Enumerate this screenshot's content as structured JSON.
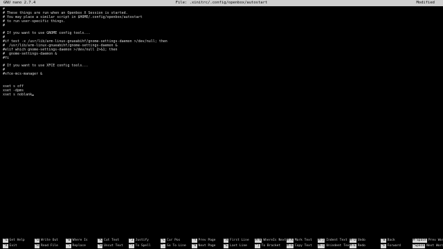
{
  "titlebar": {
    "app": "GNU nano 2.7.4",
    "file": "File: .xinitrc/.config/openbox/autostart",
    "status": "Modified"
  },
  "editor": {
    "lines": [
      "#",
      "# These things are run when an Openbox X Session is started.",
      "# You may place a similar script in $HOME/.config/openbox/autostart",
      "# to run user-specific things.",
      "#",
      "",
      "# If you want to use GNOME config tools...",
      "#",
      "#if test -x /usr/lib/arm-linux-gnueabihf/gnome-settings-daemon >/dev/null; then",
      "#  /usr/lib/arm-linux-gnueabihf/gnome-settings-daemon &",
      "#elif which gnome-settings-daemon >/dev/null 2>&1; then",
      "#  gnome-settings-daemon &",
      "#fi",
      "",
      "# If you want to use XFCE config tools...",
      "#",
      "#xfce-mcs-manager &",
      "",
      "",
      "xset s off",
      "xset -dpms",
      "xset s noblank",
      ""
    ]
  },
  "shortcuts": [
    {
      "k1": "^G",
      "l1": "Get Help",
      "k2": "^X",
      "l2": "Exit"
    },
    {
      "k1": "^O",
      "l1": "Write Out",
      "k2": "^R",
      "l2": "Read File"
    },
    {
      "k1": "^W",
      "l1": "Where Is",
      "k2": "^\\",
      "l2": "Replace"
    },
    {
      "k1": "^K",
      "l1": "Cut Text",
      "k2": "^U",
      "l2": "Uncut Text"
    },
    {
      "k1": "^J",
      "l1": "Justify",
      "k2": "^T",
      "l2": "To Spell"
    },
    {
      "k1": "^C",
      "l1": "Cur Pos",
      "k2": "^_",
      "l2": "Go To Line"
    },
    {
      "k1": "^Y",
      "l1": "Prev Page",
      "k2": "^V",
      "l2": "Next Page"
    },
    {
      "k1": "^A",
      "l1": "First Line",
      "k2": "^E",
      "l2": "Last Line"
    },
    {
      "k1": "M-W",
      "l1": "WhereIs Next",
      "k2": "^]",
      "l2": "To Bracket"
    },
    {
      "k1": "M-A",
      "l1": "Mark Text",
      "k2": "M-6",
      "l2": "Copy Text"
    },
    {
      "k1": "M-}",
      "l1": "Indent Text",
      "k2": "M-{",
      "l2": "Unindent Text"
    },
    {
      "k1": "M-U",
      "l1": "Undo",
      "k2": "M-E",
      "l2": "Redo"
    },
    {
      "k1": "^B",
      "l1": "Back",
      "k2": "^F",
      "l2": "Forward"
    },
    {
      "k1": "M-Space",
      "l1": "Prev Word",
      "k2": "^Space",
      "l2": "Next Word"
    }
  ]
}
